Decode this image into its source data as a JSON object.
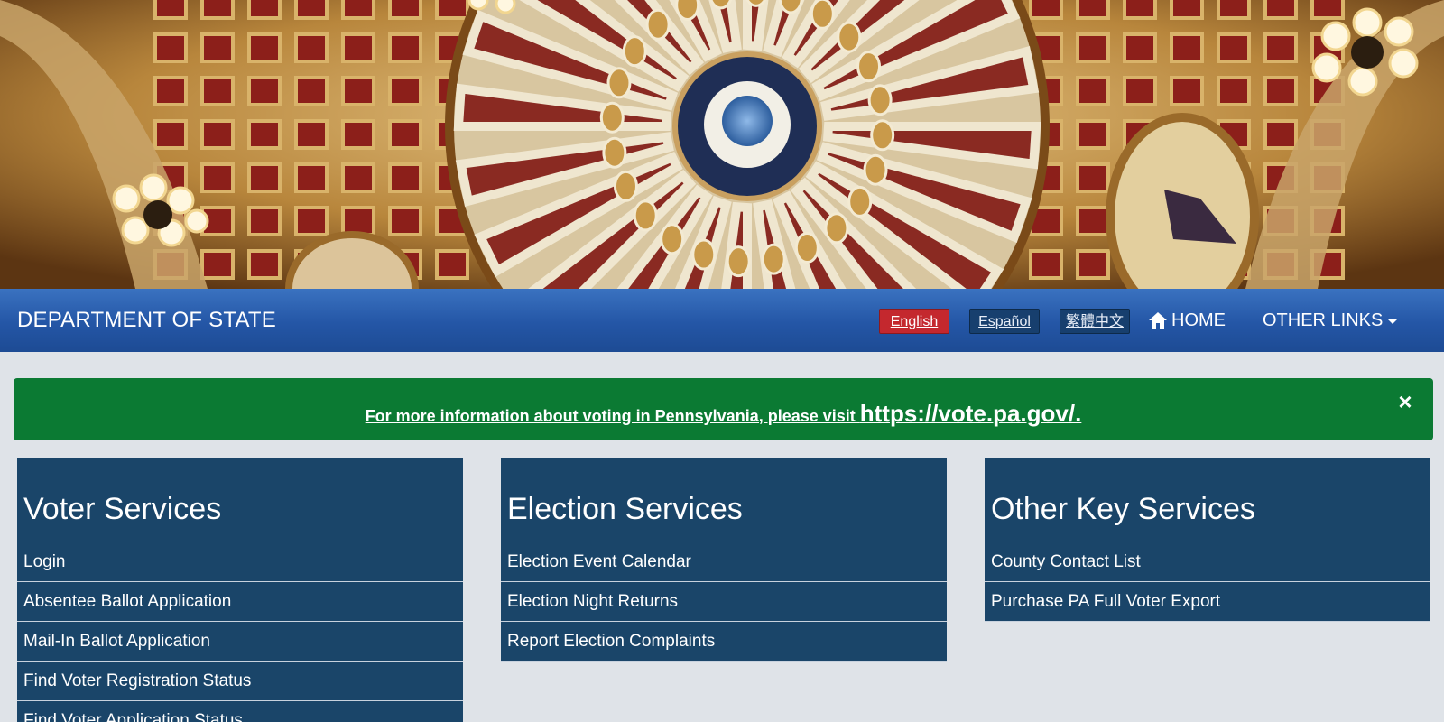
{
  "nav": {
    "brand": "DEPARTMENT OF STATE",
    "languages": [
      "English",
      "Español",
      "繁體中文"
    ],
    "home_label": "HOME",
    "other_links_label": "OTHER LINKS"
  },
  "alert": {
    "text_small": "For more information about voting in Pennsylvania, please visit ",
    "text_link": "https://vote.pa.gov/.",
    "close_glyph": "×"
  },
  "columns": [
    {
      "title": "Voter Services",
      "items": [
        "Login",
        "Absentee Ballot Application",
        "Mail-In Ballot Application",
        "Find Voter Registration Status",
        "Find Voter Application Status"
      ]
    },
    {
      "title": "Election Services",
      "items": [
        "Election Event Calendar",
        "Election Night Returns",
        "Report Election Complaints"
      ]
    },
    {
      "title": "Other Key Services",
      "items": [
        "County Contact List",
        "Purchase PA Full Voter Export"
      ]
    }
  ],
  "colors": {
    "nav_bar": "#2456a6",
    "alert_green": "#0b7a33",
    "tile_navy": "#1a4569",
    "english_red": "#c4282e"
  }
}
